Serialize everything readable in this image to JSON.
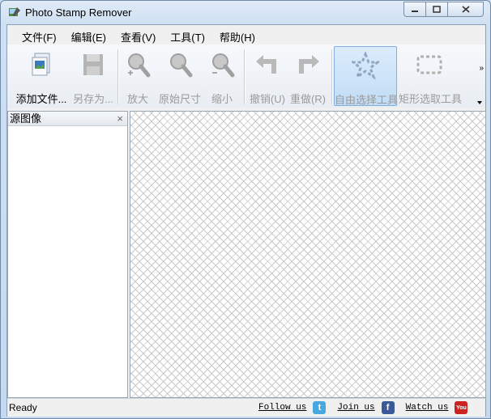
{
  "window": {
    "title": "Photo Stamp Remover"
  },
  "menu": [
    "文件(F)",
    "编辑(E)",
    "查看(V)",
    "工具(T)",
    "帮助(H)"
  ],
  "toolbar": {
    "add_file": "添加文件...",
    "save_as": "另存为...",
    "zoom_in": "放大",
    "original_size": "原始尺寸",
    "zoom_out": "缩小",
    "undo": "撤销(U)",
    "redo": "重做(R)",
    "free_select": "自由选择工具",
    "rect_select": "矩形选取工具",
    "overflow": "»"
  },
  "left_panel": {
    "title": "源图像",
    "close": "×"
  },
  "status": {
    "text": "Ready",
    "follow": "Follow us",
    "join": "Join us",
    "watch": "Watch us"
  },
  "colors": {
    "twitter": "#4aa8e0",
    "facebook": "#3b5998",
    "youtube": "#cc2222",
    "active_tool": "#c2dcf5"
  }
}
